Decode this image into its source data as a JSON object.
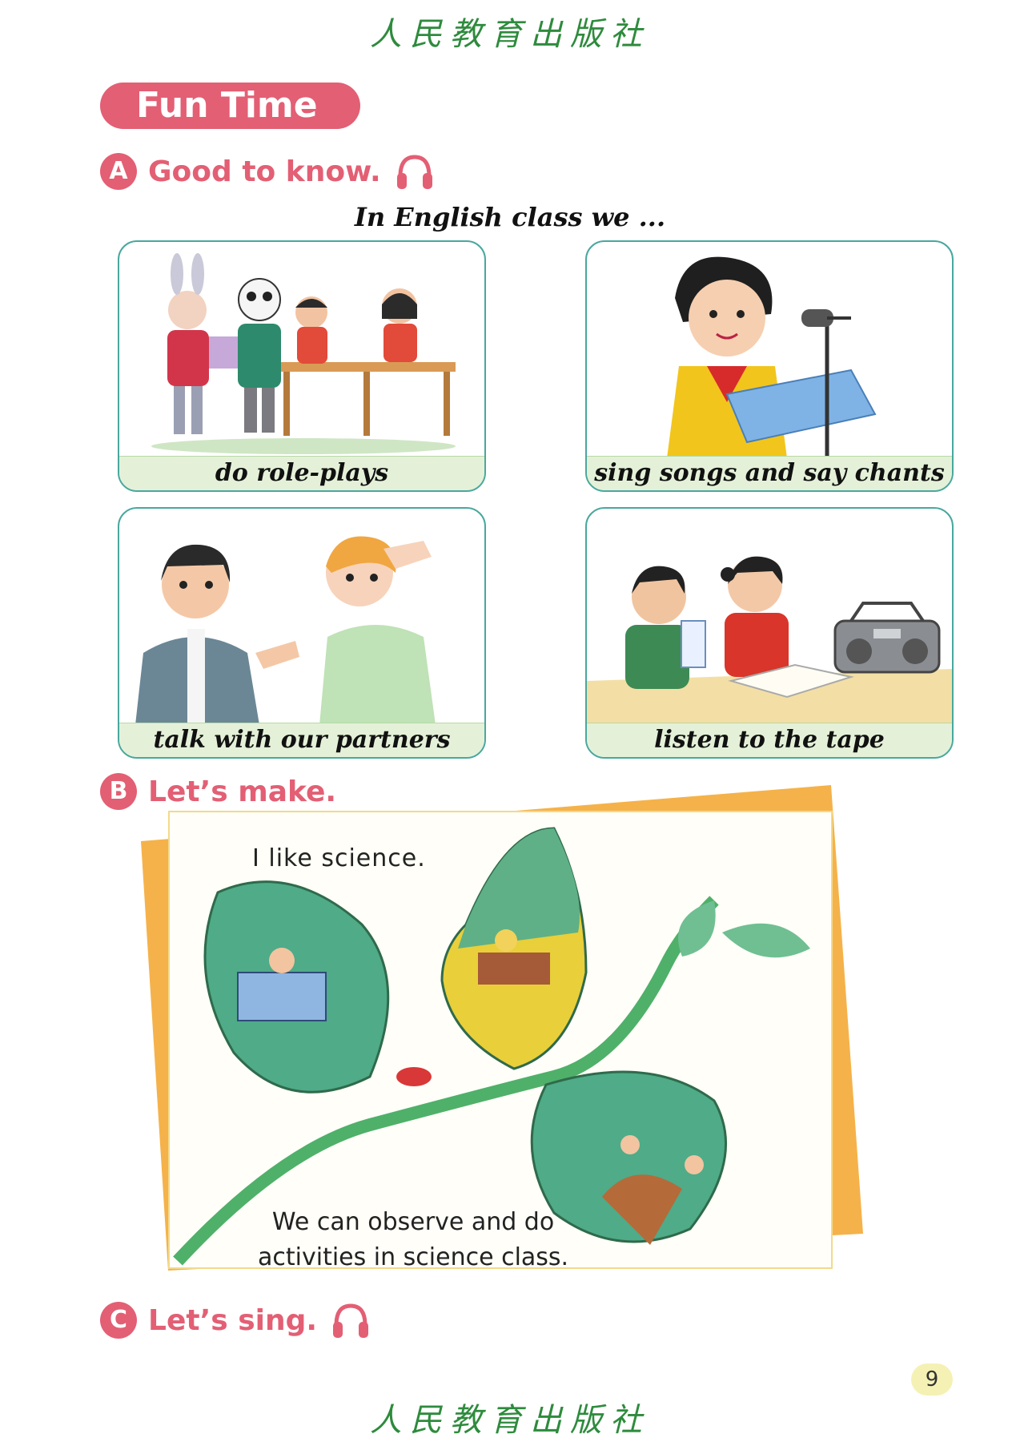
{
  "publisher": "人民教育出版社",
  "banner": {
    "label": "Fun Time"
  },
  "sections": {
    "a": {
      "letter": "A",
      "title": "Good to know."
    },
    "b": {
      "letter": "B",
      "title": "Let’s make."
    },
    "c": {
      "letter": "C",
      "title": "Let’s sing."
    }
  },
  "lead_text": "In English class we ...",
  "cards": [
    {
      "caption": "do role-plays"
    },
    {
      "caption": "sing songs and say chants"
    },
    {
      "caption": "talk with our partners"
    },
    {
      "caption": "listen to the tape"
    }
  ],
  "make": {
    "title": "I like science.",
    "line1": "We can observe and do",
    "line2": "activities in science class."
  },
  "page_number": "9",
  "colors": {
    "accent": "#e35f74",
    "card_border": "#49a89e",
    "caption_bg": "#e4f1d8",
    "publisher": "#2e8b3d"
  }
}
